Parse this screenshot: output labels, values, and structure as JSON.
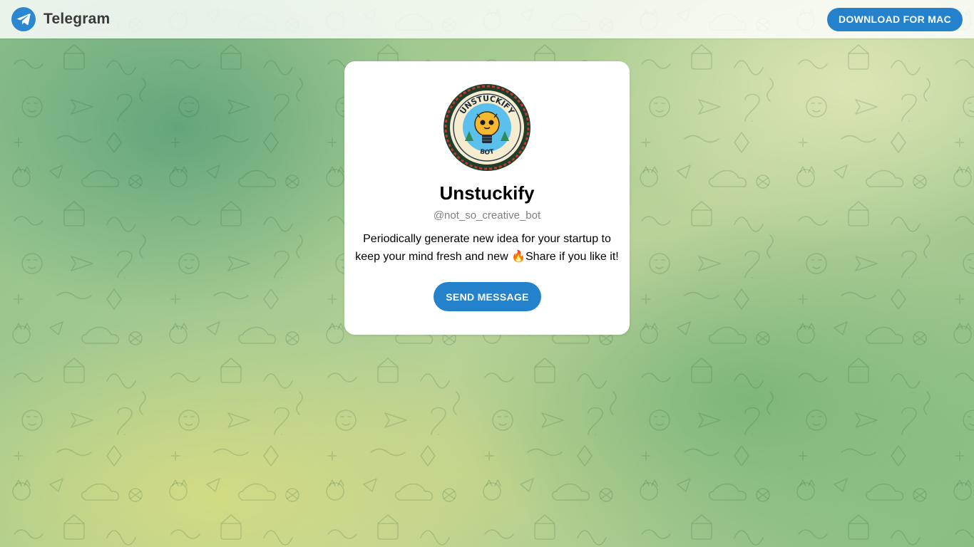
{
  "header": {
    "app_name": "Telegram",
    "logo_icon": "telegram-plane-icon",
    "download_label": "DOWNLOAD FOR MAC"
  },
  "profile": {
    "avatar_icon": "unstuckify-bot-avatar",
    "avatar_text_top": "UNSTUCKIFY",
    "avatar_text_bottom": "BOT",
    "name": "Unstuckify",
    "username": "@not_so_creative_bot",
    "description": "Periodically generate new idea for your startup to keep your mind fresh and new 🔥Share if you like it!",
    "send_label": "SEND MESSAGE"
  },
  "colors": {
    "accent": "#2481cc",
    "background_green": "#8cbf8c",
    "background_yellow": "#d7dc82"
  }
}
